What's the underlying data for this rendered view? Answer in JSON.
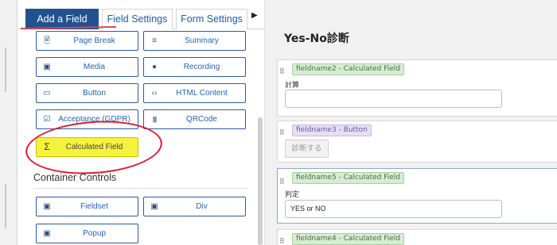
{
  "tabs": [
    {
      "label": "Add a Field"
    },
    {
      "label": "Field Settings"
    },
    {
      "label": "Form Settings"
    }
  ],
  "tab_more_glyph": "▶",
  "fields_grid": [
    {
      "icon": "🖹",
      "icon_name": "page-break-icon",
      "label": "Page Break"
    },
    {
      "icon": "≡",
      "icon_name": "summary-icon",
      "label": "Summary"
    },
    {
      "icon": "▣",
      "icon_name": "media-icon",
      "label": "Media"
    },
    {
      "icon": "●",
      "icon_name": "recording-icon",
      "label": "Recording"
    },
    {
      "icon": "▭",
      "icon_name": "button-icon",
      "label": "Button"
    },
    {
      "icon": "‹›",
      "icon_name": "code-icon",
      "label": "HTML Content"
    },
    {
      "icon": "☑",
      "icon_name": "checkbox-icon",
      "label": "Acceptance (GDPR)"
    },
    {
      "icon": "||||",
      "icon_name": "qrcode-icon",
      "label": "QRCode"
    },
    {
      "icon": "Σ",
      "icon_name": "sigma-icon",
      "label": "Calculated Field"
    }
  ],
  "container_section": {
    "heading": "Container Controls",
    "items": [
      {
        "icon": "▣",
        "icon_name": "fieldset-icon",
        "label": "Fieldset"
      },
      {
        "icon": "▣",
        "icon_name": "div-icon",
        "label": "Div"
      },
      {
        "icon": "▣",
        "icon_name": "popup-icon",
        "label": "Popup"
      }
    ]
  },
  "form": {
    "title": "Yes-No診断",
    "fields": [
      {
        "tag": "fieldname2 - Calculated Field",
        "label": "計算",
        "value": ""
      },
      {
        "tag": "fieldname3 - Button",
        "button_label": "診断する"
      },
      {
        "tag": "fieldname5 - Calculated Field",
        "label": "判定",
        "value": "YES or NO"
      },
      {
        "tag": "fieldname4 - Calculated Field"
      }
    ]
  },
  "colors": {
    "active_tab": "#21528f",
    "highlight": "#f4f23a",
    "annotation": "#e3182c"
  }
}
